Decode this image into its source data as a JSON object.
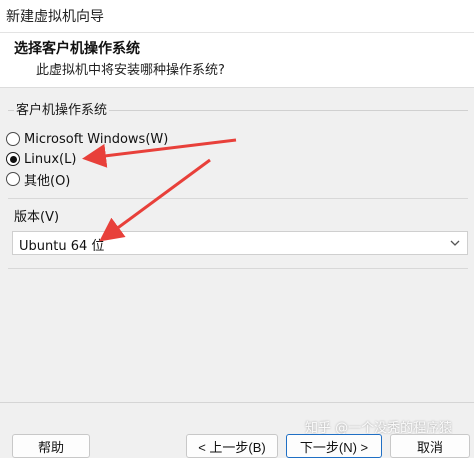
{
  "window": {
    "title": "新建虚拟机向导"
  },
  "header": {
    "title": "选择客户机操作系统",
    "subtitle": "此虚拟机中将安装哪种操作系统?"
  },
  "guest_os": {
    "legend": "客户机操作系统",
    "options": [
      {
        "label": "Microsoft Windows(W)",
        "checked": false
      },
      {
        "label": "Linux(L)",
        "checked": true
      },
      {
        "label": "其他(O)",
        "checked": false
      }
    ]
  },
  "version": {
    "label": "版本(V)",
    "selected": "Ubuntu 64 位"
  },
  "footer": {
    "help": "帮助",
    "back": "< 上一步(B)",
    "next": "下一步(N) >",
    "cancel": "取消"
  },
  "watermark": "知乎 @一个没秃的程序猿",
  "colors": {
    "annotation_arrow": "#e8403a",
    "primary_border": "#1f6fc4"
  },
  "icons": {
    "select_chevron": "chevron-down-icon"
  }
}
